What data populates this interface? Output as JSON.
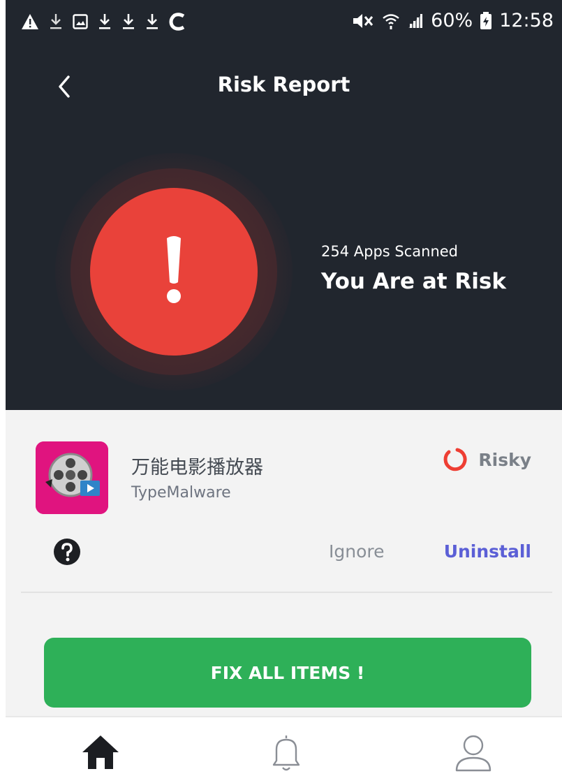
{
  "status_bar": {
    "left_icons": [
      "warning-icon",
      "download-icon",
      "image-icon",
      "download-icon",
      "download-icon",
      "download-icon",
      "c-icon"
    ],
    "right_icons": [
      "mute-icon",
      "wifi-icon",
      "signal-icon"
    ],
    "battery_percent": "60%",
    "time": "12:58"
  },
  "header": {
    "title": "Risk Report",
    "back_icon": "chevron-left-icon"
  },
  "scan": {
    "apps_scanned": "254 Apps Scanned",
    "status_message": "You Are at Risk",
    "alert_icon": "exclamation-icon",
    "colors": {
      "alert": "#e9423a",
      "header_bg": "#21262e"
    }
  },
  "risk_item": {
    "app_name": "万能电影播放器",
    "app_type": "TypeMalware",
    "status": "Risky",
    "status_icon": "risk-ring-icon",
    "help_icon": "question-icon",
    "ignore_label": "Ignore",
    "uninstall_label": "Uninstall",
    "colors": {
      "uninstall": "#5b5fd6",
      "status_ring": "#ee3e33"
    }
  },
  "fix_button": {
    "label": "FIX ALL ITEMS !",
    "color": "#2eb058"
  },
  "bottom_nav": {
    "items": [
      "home-icon",
      "bell-icon",
      "profile-icon"
    ],
    "active": "home-icon"
  }
}
